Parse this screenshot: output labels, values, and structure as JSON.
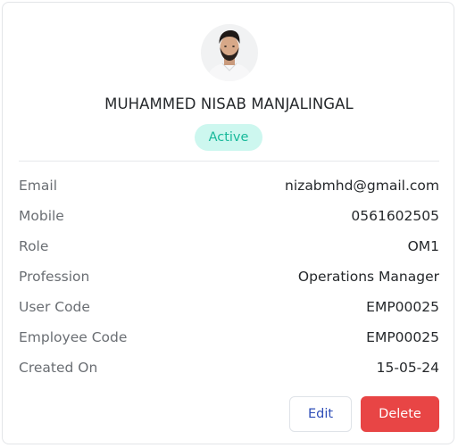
{
  "profile": {
    "name": "MUHAMMED NISAB MANJALINGAL",
    "status": "Active"
  },
  "details": [
    {
      "label": "Email",
      "value": "nizabmhd@gmail.com"
    },
    {
      "label": "Mobile",
      "value": "0561602505"
    },
    {
      "label": "Role",
      "value": "OM1"
    },
    {
      "label": "Profession",
      "value": "Operations Manager"
    },
    {
      "label": "User Code",
      "value": "EMP00025"
    },
    {
      "label": "Employee Code",
      "value": "EMP00025"
    },
    {
      "label": "Created On",
      "value": "15-05-24"
    }
  ],
  "actions": {
    "edit_label": "Edit",
    "delete_label": "Delete"
  },
  "colors": {
    "status_bg": "#cdf7ef",
    "status_text": "#18b99a",
    "delete_bg": "#e84545",
    "edit_text": "#2f4fb8"
  }
}
